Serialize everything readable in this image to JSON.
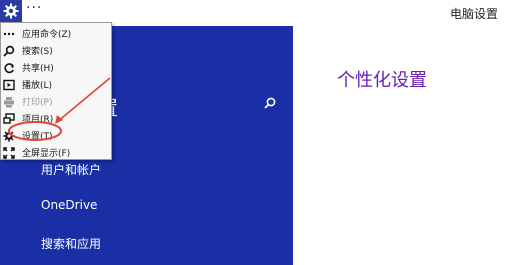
{
  "titlebar": {
    "dots": "···",
    "title": "电脑设置"
  },
  "left_pane": {
    "heading": "置",
    "nav_items": [
      "用户和帐户",
      "OneDrive",
      "搜索和应用"
    ]
  },
  "right_pane": {
    "title": "个性化设置"
  },
  "context_menu": {
    "items": [
      {
        "label": "应用命令(Z)",
        "icon": "more-icon",
        "enabled": true
      },
      {
        "label": "搜索(S)",
        "icon": "search-icon",
        "enabled": true
      },
      {
        "label": "共享(H)",
        "icon": "share-icon",
        "enabled": true
      },
      {
        "label": "播放(L)",
        "icon": "play-icon",
        "enabled": true
      },
      {
        "label": "打印(P)",
        "icon": "print-icon",
        "enabled": false
      },
      {
        "label": "项目(R)",
        "icon": "devices-icon",
        "enabled": true
      },
      {
        "label": "设置(T)",
        "icon": "gear-icon",
        "enabled": true,
        "highlighted": true
      },
      {
        "label": "全屏显示(F)",
        "icon": "fullscreen-icon",
        "enabled": true
      }
    ]
  },
  "colors": {
    "accent_blue": "#1a2fa6",
    "title_purple": "#6a1fb5",
    "annotation_red": "#e0453a"
  }
}
